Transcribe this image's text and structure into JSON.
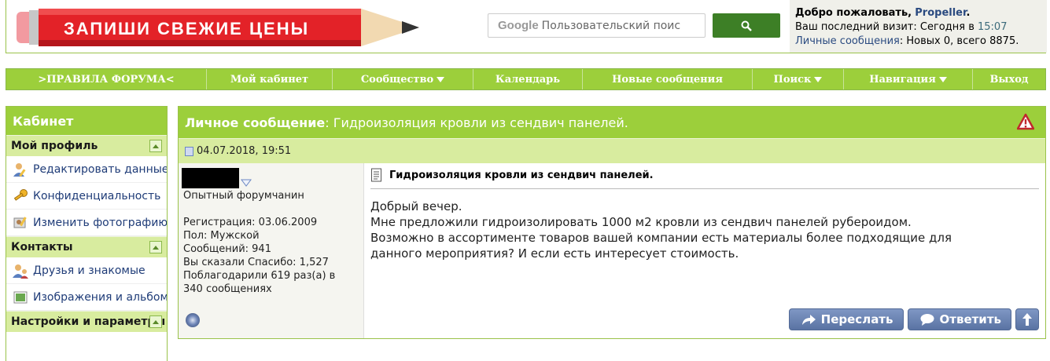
{
  "banner": {
    "text": "ЗАПИШИ СВЕЖИЕ ЦЕНЫ"
  },
  "search": {
    "brand": "Google",
    "placeholder": "Пользовательский поис"
  },
  "welcome": {
    "greeting": "Добро пожаловать,",
    "username": "Propeller",
    "last_visit_label": "Ваш последний визит: Сегодня в",
    "last_visit_time": "15:07",
    "pm_link": "Личные сообщения",
    "pm_counts": ": Новых 0, всего 8875."
  },
  "nav": {
    "rules": ">ПРАВИЛА ФОРУМА<",
    "cabinet": "Мой кабинет",
    "community": "Сообщество",
    "calendar": "Календарь",
    "new_posts": "Новые сообщения",
    "search": "Поиск",
    "navigation": "Навигация",
    "logout": "Выход"
  },
  "sidebar": {
    "title": "Кабинет",
    "profile_section": "Мой профиль",
    "edit_data": "Редактировать данные",
    "privacy": "Конфиденциальность",
    "change_photo": "Изменить фотографию",
    "contacts_section": "Контакты",
    "friends": "Друзья и знакомые",
    "images": "Изображения и альбомы",
    "settings_section": "Настройки и параметры"
  },
  "pm": {
    "header_label": "Личное сообщение",
    "header_subject": ": Гидроизоляция кровли из сендвич панелей.",
    "date": "04.07.2018, 19:51",
    "title": "Гидроизоляция кровли из сендвич панелей.",
    "body": [
      "Добрый вечер.",
      "Мне предложили гидроизолировать 1000 м2 кровли из сендвич панелей рубероидом.",
      "Возможно в ассортименте товаров вашей компании есть материалы более подходящие для",
      "данного мероприятия? И если есть интересует стоимость."
    ]
  },
  "user": {
    "rank": "Опытный форумчанин",
    "registration": "Регистрация: 03.06.2009",
    "gender": "Пол: Мужской",
    "posts": "Сообщений: 941",
    "thanks_given": "Вы сказали Спасибо: 1,527",
    "thanked": "Поблагодарили 619 раз(а) в",
    "thanked_posts": "340 сообщениях"
  },
  "buttons": {
    "forward": "Переслать",
    "reply": "Ответить"
  },
  "colors": {
    "accent_green": "#9ccf3b",
    "light_green": "#d8ec9f",
    "button_blue": "#6a82b3",
    "search_green": "#3d7f26"
  }
}
